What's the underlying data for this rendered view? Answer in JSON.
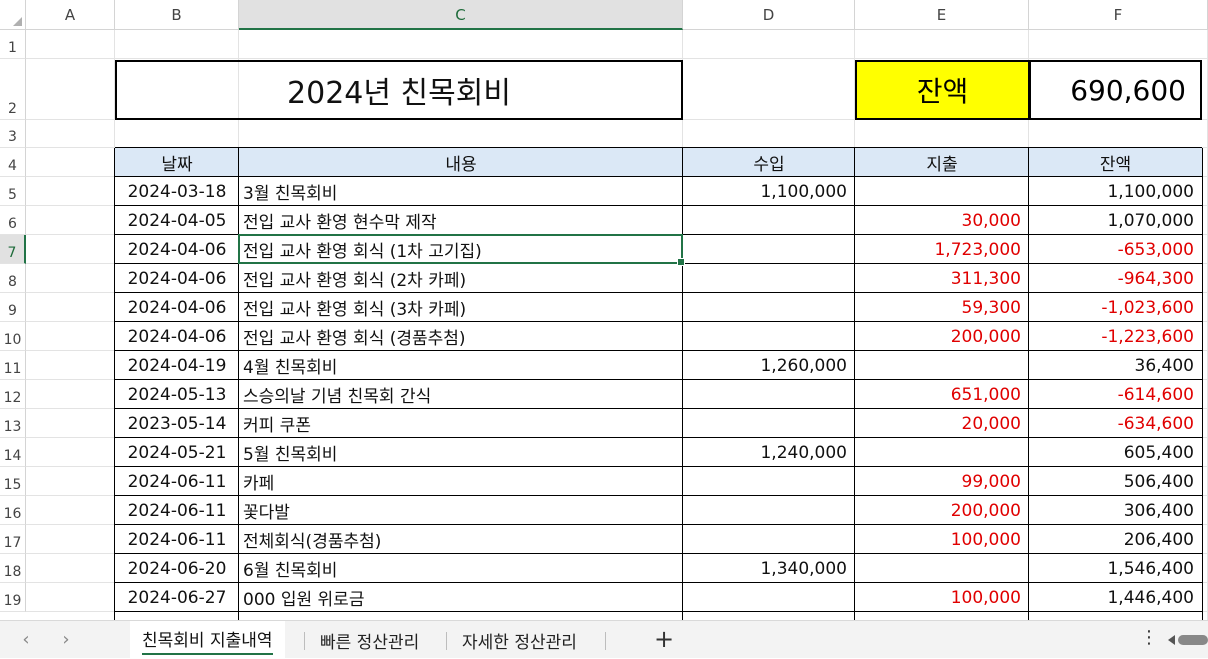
{
  "columns": [
    "A",
    "B",
    "C",
    "D",
    "E",
    "F"
  ],
  "active_column": "C",
  "active_row": 7,
  "rows": [
    "1",
    "2",
    "3",
    "4",
    "5",
    "6",
    "7",
    "8",
    "9",
    "10",
    "11",
    "12",
    "13",
    "14",
    "15",
    "16",
    "17",
    "18",
    "19"
  ],
  "title": "2024년 친목회비",
  "balance_label": "잔액",
  "balance_value": "690,600",
  "colors": {
    "balance_label_bg": "#ffff00",
    "header_bg": "#dbe8f6",
    "negative": "#e00000",
    "accent": "#217346"
  },
  "table": {
    "headers": [
      "날짜",
      "내용",
      "수입",
      "지출",
      "잔액"
    ],
    "rows": [
      {
        "date": "2024-03-18",
        "desc": "3월 친목회비",
        "income": "1,100,000",
        "expense": "",
        "balance": "1,100,000",
        "neg": false
      },
      {
        "date": "2024-04-05",
        "desc": "전입 교사 환영 현수막 제작",
        "income": "",
        "expense": "30,000",
        "balance": "1,070,000",
        "neg": false
      },
      {
        "date": "2024-04-06",
        "desc": "전입 교사 환영 회식 (1차 고기집)",
        "income": "",
        "expense": "1,723,000",
        "balance": "-653,000",
        "neg": true
      },
      {
        "date": "2024-04-06",
        "desc": "전입 교사 환영 회식 (2차 카페)",
        "income": "",
        "expense": "311,300",
        "balance": "-964,300",
        "neg": true
      },
      {
        "date": "2024-04-06",
        "desc": "전입 교사 환영 회식 (3차 카페)",
        "income": "",
        "expense": "59,300",
        "balance": "-1,023,600",
        "neg": true
      },
      {
        "date": "2024-04-06",
        "desc": "전입 교사 환영 회식 (경품추첨)",
        "income": "",
        "expense": "200,000",
        "balance": "-1,223,600",
        "neg": true
      },
      {
        "date": "2024-04-19",
        "desc": "4월 친목회비",
        "income": "1,260,000",
        "expense": "",
        "balance": "36,400",
        "neg": false
      },
      {
        "date": "2024-05-13",
        "desc": "스승의날 기념 친목회 간식",
        "income": "",
        "expense": "651,000",
        "balance": "-614,600",
        "neg": true
      },
      {
        "date": "2023-05-14",
        "desc": "커피 쿠폰",
        "income": "",
        "expense": "20,000",
        "balance": "-634,600",
        "neg": true
      },
      {
        "date": "2024-05-21",
        "desc": "5월 친목회비",
        "income": "1,240,000",
        "expense": "",
        "balance": "605,400",
        "neg": false
      },
      {
        "date": "2024-06-11",
        "desc": "카페",
        "income": "",
        "expense": "99,000",
        "balance": "506,400",
        "neg": false
      },
      {
        "date": "2024-06-11",
        "desc": "꽃다발",
        "income": "",
        "expense": "200,000",
        "balance": "306,400",
        "neg": false
      },
      {
        "date": "2024-06-11",
        "desc": "전체회식(경품추첨)",
        "income": "",
        "expense": "100,000",
        "balance": "206,400",
        "neg": false
      },
      {
        "date": "2024-06-20",
        "desc": "6월 친목회비",
        "income": "1,340,000",
        "expense": "",
        "balance": "1,546,400",
        "neg": false
      },
      {
        "date": "2024-06-27",
        "desc": "000 입원 위로금",
        "income": "",
        "expense": "100,000",
        "balance": "1,446,400",
        "neg": false
      }
    ]
  },
  "tabs": [
    "친목회비 지출내역",
    "빠른 정산관리",
    "자세한 정산관리"
  ],
  "active_tab": 0,
  "nav": {
    "prev": "‹",
    "next": "›",
    "add": "+",
    "more": "⋮"
  }
}
